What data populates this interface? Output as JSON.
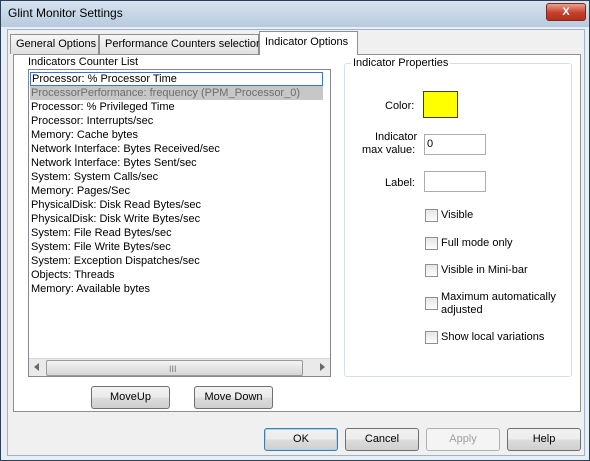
{
  "window": {
    "title": "Glint Monitor Settings",
    "close_symbol": "X"
  },
  "tabs": [
    {
      "label": "General Options"
    },
    {
      "label": "Performance Counters selection"
    },
    {
      "label": "Indicator Options"
    }
  ],
  "list_panel": {
    "heading": "Indicators Counter List",
    "items": [
      "Processor: % Processor Time",
      "ProcessorPerformance: frequency (PPM_Processor_0)",
      "Processor: % Privileged Time",
      "Processor: Interrupts/sec",
      "Memory: Cache bytes",
      "Network Interface: Bytes Received/sec",
      "Network Interface: Bytes Sent/sec",
      "System: System Calls/sec",
      "Memory: Pages/Sec",
      "PhysicalDisk: Disk Read Bytes/sec",
      "PhysicalDisk: Disk Write Bytes/sec",
      "System: File Read Bytes/sec",
      "System: File Write Bytes/sec",
      "System: Exception Dispatches/sec",
      "Objects: Threads",
      "Memory: Available bytes"
    ],
    "focused_index": 0,
    "selected_index": 1,
    "scrollbar_grip": "III",
    "move_up_label": "MoveUp",
    "move_down_label": "Move Down"
  },
  "properties": {
    "heading": "Indicator Properties",
    "color_label": "Color:",
    "color_value": "#ffff00",
    "max_label_line1": "Indicator",
    "max_label_line2": "max value:",
    "max_value": "0",
    "label_label": "Label:",
    "label_value": "",
    "checkboxes": {
      "visible": {
        "label": "Visible",
        "checked": false
      },
      "full_mode": {
        "label": "Full mode only",
        "checked": false
      },
      "mini_bar": {
        "label": "Visible in Mini-bar",
        "checked": false
      },
      "auto_max": {
        "label_line1": "Maximum automatically",
        "label_line2": "adjusted",
        "checked": false
      },
      "local_var": {
        "label": "Show local variations",
        "checked": false
      }
    }
  },
  "buttons": {
    "ok": "OK",
    "cancel": "Cancel",
    "apply": "Apply",
    "help": "Help"
  }
}
